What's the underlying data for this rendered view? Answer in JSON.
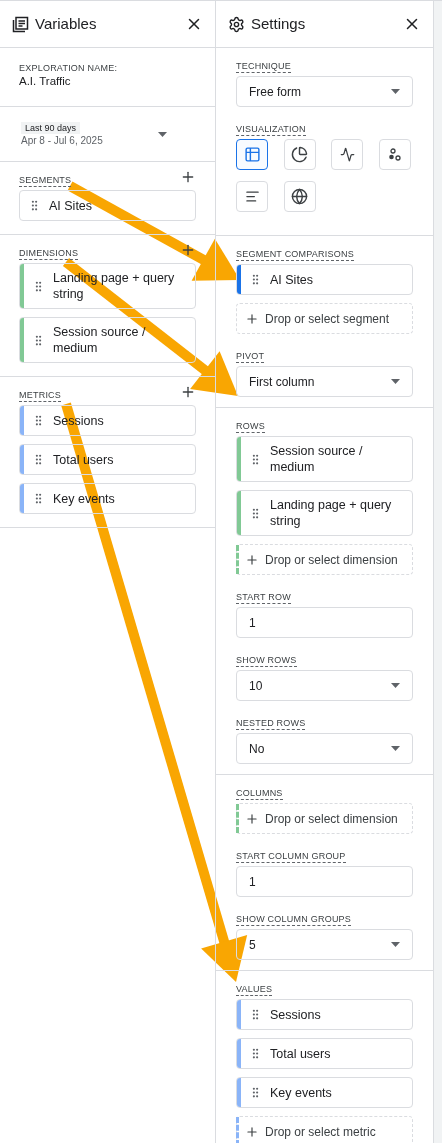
{
  "variables_panel": {
    "title": "Variables",
    "exploration_name_label": "EXPLORATION NAME:",
    "exploration_name": "A.I. Traffic",
    "date_range": {
      "preset": "Last 90 days",
      "range": "Apr 8 - Jul 6, 2025"
    },
    "sections": [
      {
        "label": "SEGMENTS",
        "items": [
          "AI Sites"
        ]
      },
      {
        "label": "DIMENSIONS",
        "color": "#81c995",
        "items": [
          "Landing page + query string",
          "Session source / medium"
        ]
      },
      {
        "label": "METRICS",
        "color": "#8ab4f8",
        "items": [
          "Sessions",
          "Total users",
          "Key events"
        ]
      }
    ]
  },
  "settings_panel": {
    "title": "Settings",
    "groups": [
      {
        "fields": [
          {
            "kind": "select",
            "label": "TECHNIQUE",
            "value": "Free form"
          },
          {
            "kind": "visualization",
            "label": "VISUALIZATION",
            "options": [
              {
                "kind": "table",
                "selected": true
              },
              {
                "kind": "donut",
                "selected": false
              },
              {
                "kind": "line",
                "selected": false
              },
              {
                "kind": "scatter",
                "selected": false
              },
              {
                "kind": "bar",
                "selected": false
              },
              {
                "kind": "geo",
                "selected": false
              }
            ]
          }
        ]
      },
      {
        "fields": [
          {
            "kind": "chips",
            "label": "SEGMENT COMPARISONS",
            "color": "#1a73e8",
            "items": [
              "AI Sites"
            ],
            "drop": {
              "text": "Drop or select segment"
            }
          },
          {
            "kind": "select",
            "label": "PIVOT",
            "value": "First column"
          }
        ]
      },
      {
        "fields": [
          {
            "kind": "chips",
            "label": "ROWS",
            "color": "#81c995",
            "items": [
              "Session source / medium",
              "Landing page + query string"
            ],
            "drop": {
              "text": "Drop or select dimension",
              "color": "#81c995"
            }
          },
          {
            "kind": "input",
            "label": "START ROW",
            "value": "1"
          },
          {
            "kind": "select",
            "label": "SHOW ROWS",
            "value": "10"
          },
          {
            "kind": "select",
            "label": "NESTED ROWS",
            "value": "No"
          }
        ]
      },
      {
        "fields": [
          {
            "kind": "chips",
            "label": "COLUMNS",
            "drop": {
              "text": "Drop or select dimension",
              "color": "#81c995"
            }
          },
          {
            "kind": "input",
            "label": "START COLUMN GROUP",
            "value": "1"
          },
          {
            "kind": "select",
            "label": "SHOW COLUMN GROUPS",
            "value": "5"
          }
        ]
      },
      {
        "fields": [
          {
            "kind": "chips",
            "label": "VALUES",
            "color": "#8ab4f8",
            "items": [
              "Sessions",
              "Total users",
              "Key events"
            ],
            "drop": {
              "text": "Drop or select metric",
              "color": "#8ab4f8"
            }
          }
        ]
      }
    ]
  }
}
